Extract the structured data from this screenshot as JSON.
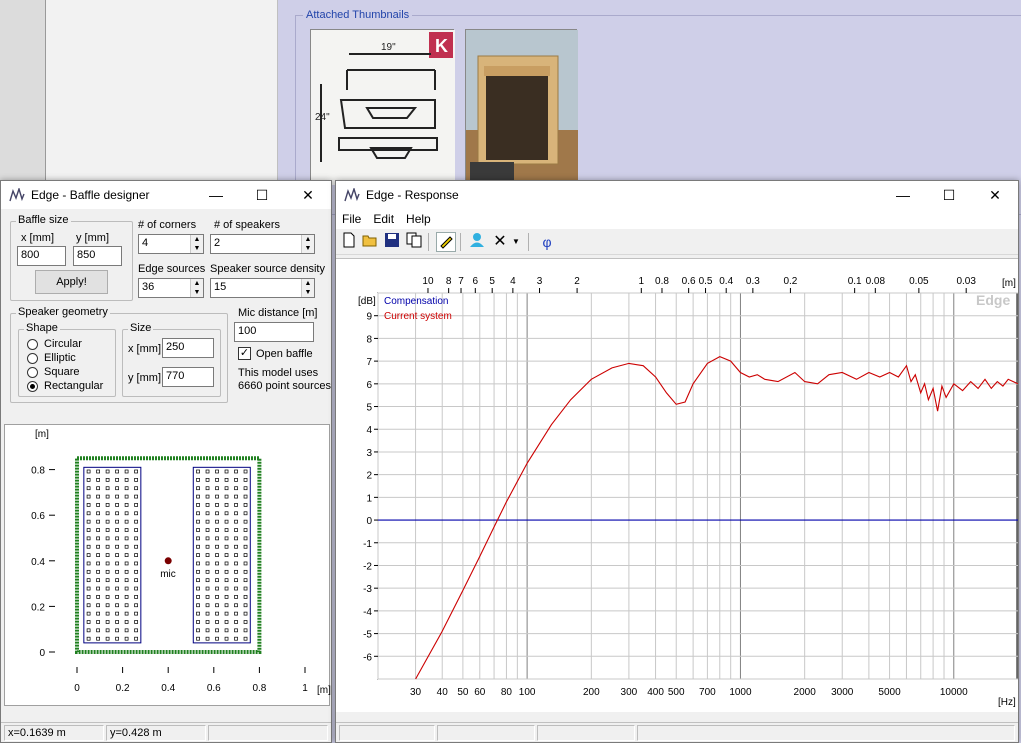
{
  "background": {
    "thumbnails_legend": "Attached Thumbnails",
    "thumb_sketch_note": "19\"",
    "thumb_sketch_note2": "24\"",
    "thumb_sketch_badge": "K"
  },
  "baffle": {
    "title": "Edge - Baffle designer",
    "baffle_size_legend": "Baffle size",
    "x_label": "x [mm]",
    "y_label": "y [mm]",
    "x_value": "800",
    "y_value": "850",
    "apply_label": "Apply!",
    "corners_label": "# of corners",
    "corners_value": "4",
    "speakers_label": "# of speakers",
    "speakers_value": "2",
    "edge_sources_label": "Edge sources",
    "edge_sources_value": "36",
    "density_label": "Speaker source density",
    "density_value": "15",
    "geometry_legend": "Speaker geometry",
    "shape_legend": "Shape",
    "shapes": [
      {
        "label": "Circular",
        "selected": false
      },
      {
        "label": "Elliptic",
        "selected": false
      },
      {
        "label": "Square",
        "selected": false
      },
      {
        "label": "Rectangular",
        "selected": true
      }
    ],
    "size_legend": "Size",
    "size_x_label": "x [mm]",
    "size_x_value": "250",
    "size_y_label": "y [mm]",
    "size_y_value": "770",
    "mic_label": "Mic distance [m]",
    "mic_value": "100",
    "open_baffle_label": "Open baffle",
    "open_baffle_checked": true,
    "model_line1": "This model uses",
    "model_line2": "6660 point sources",
    "status_x": "x=0.1639 m",
    "status_y": "y=0.428 m",
    "plot": {
      "y_unit": "[m]",
      "x_unit": "[m]",
      "y_ticks": [
        "0.8",
        "0.6",
        "0.4",
        "0.2",
        "0"
      ],
      "x_ticks": [
        "0",
        "0.2",
        "0.4",
        "0.6",
        "0.8",
        "1"
      ],
      "mic_label": "mic"
    }
  },
  "response": {
    "title": "Edge - Response",
    "menu": [
      "File",
      "Edit",
      "Help"
    ],
    "toolbar_icons": [
      "new-icon",
      "open-icon",
      "save-icon",
      "copy-icon",
      "pencil-icon",
      "person-icon",
      "delete-icon",
      "dropdown-icon",
      "phase-icon"
    ],
    "phase_symbol": "φ",
    "watermark": "Edge"
  },
  "chart_data": {
    "type": "line",
    "xscale": "log",
    "xlabel": "[Hz]",
    "ylabel": "[dB]",
    "top_axis_unit": "[m]",
    "xlim": [
      20,
      20000
    ],
    "ylim": [
      -7,
      10
    ],
    "x_tick_labels": [
      "30",
      "40",
      "50",
      "60",
      "80",
      "100",
      "200",
      "300",
      "400",
      "500",
      "700",
      "1000",
      "2000",
      "3000",
      "5000",
      "10000"
    ],
    "x_tick_values": [
      30,
      40,
      50,
      60,
      80,
      100,
      200,
      300,
      400,
      500,
      700,
      1000,
      2000,
      3000,
      5000,
      10000
    ],
    "top_tick_labels": [
      "10",
      "8",
      "7",
      "6",
      "5",
      "4",
      "3",
      "2",
      "1",
      "0.8",
      "0.6",
      "0.5",
      "0.4",
      "0.3",
      "0.2",
      "0.1",
      "0.08",
      "0.05",
      "0.03"
    ],
    "top_tick_values": [
      10,
      8,
      7,
      6,
      5,
      4,
      3,
      2,
      1,
      0.8,
      0.6,
      0.5,
      0.4,
      0.3,
      0.2,
      0.1,
      0.08,
      0.05,
      0.03
    ],
    "y_tick_labels": [
      "9",
      "8",
      "7",
      "6",
      "5",
      "4",
      "3",
      "2",
      "1",
      "0",
      "-1",
      "-2",
      "-3",
      "-4",
      "-5",
      "-6"
    ],
    "series": [
      {
        "name": "Compensation",
        "color": "#0000aa",
        "x": [
          20,
          20000
        ],
        "y": [
          0,
          0
        ]
      },
      {
        "name": "Current system",
        "color": "#cc0000",
        "x": [
          30,
          40,
          50,
          60,
          70,
          80,
          100,
          130,
          160,
          200,
          250,
          300,
          350,
          400,
          450,
          500,
          550,
          600,
          700,
          800,
          900,
          1000,
          1100,
          1200,
          1300,
          1500,
          1800,
          2000,
          2300,
          2600,
          3000,
          3500,
          4000,
          4500,
          5000,
          5500,
          6000,
          6300,
          6600,
          7000,
          7300,
          7600,
          8000,
          8400,
          8800,
          9200,
          10000,
          11000,
          12000,
          13000,
          14000,
          15000,
          16000,
          17000,
          18000,
          20000
        ],
        "y": [
          -7.0,
          -4.9,
          -3.1,
          -1.6,
          -0.3,
          0.8,
          2.5,
          4.2,
          5.3,
          6.2,
          6.7,
          6.9,
          6.8,
          6.3,
          5.6,
          5.1,
          5.2,
          6.0,
          6.9,
          7.2,
          7.0,
          6.5,
          6.3,
          6.4,
          6.2,
          6.1,
          6.5,
          6.1,
          6.0,
          6.4,
          6.5,
          6.2,
          6.5,
          6.3,
          6.5,
          6.3,
          6.8,
          6.1,
          6.4,
          5.6,
          6.0,
          5.3,
          5.8,
          4.8,
          5.9,
          5.4,
          6.0,
          5.7,
          6.1,
          5.8,
          6.2,
          5.8,
          6.1,
          5.9,
          6.2,
          6.0
        ]
      }
    ]
  }
}
